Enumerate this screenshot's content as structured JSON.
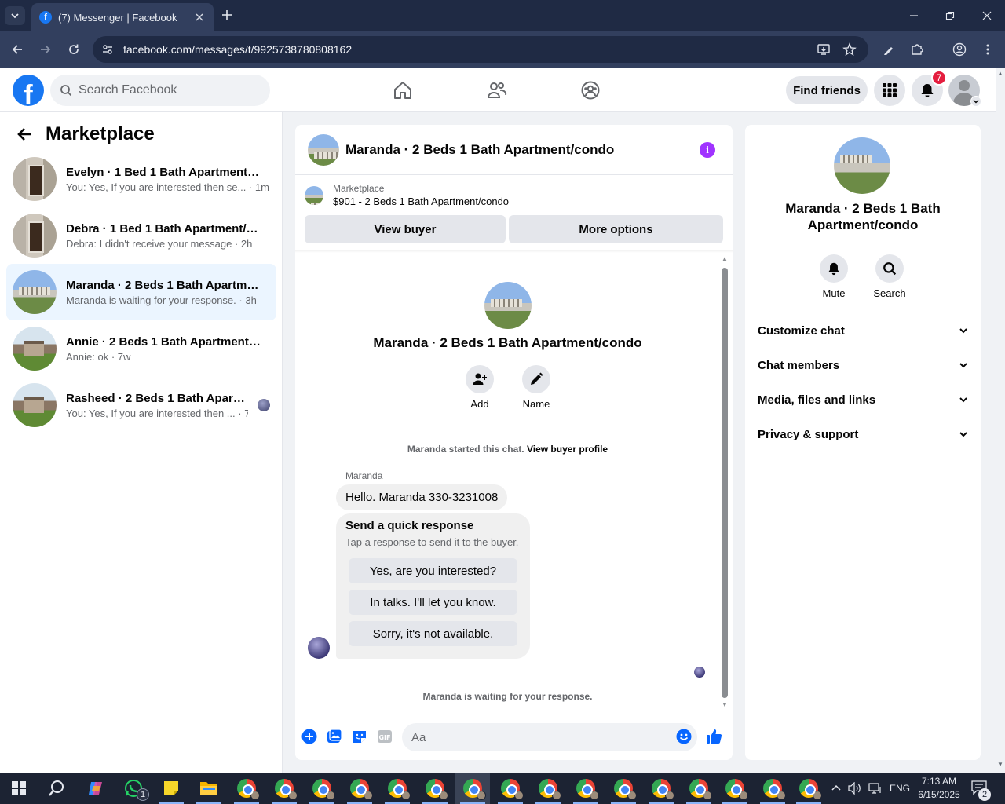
{
  "browser": {
    "tab_title": "(7) Messenger | Facebook",
    "url": "facebook.com/messages/t/9925738780808162"
  },
  "header": {
    "search_placeholder": "Search Facebook",
    "find_friends_label": "Find friends",
    "notification_count": "7"
  },
  "sidebar": {
    "title": "Marketplace",
    "conversations": [
      {
        "name": "Evelyn · 1 Bed 1 Bath Apartment/c...",
        "preview": "You: Yes, If you are interested then se...",
        "time": "1m"
      },
      {
        "name": "Debra · 1 Bed 1 Bath Apartment/co...",
        "preview": "Debra: I didn't receive your message",
        "time": "2h"
      },
      {
        "name": "Maranda · 2 Beds 1 Bath Apartmen...",
        "preview": "Maranda is waiting for your response.",
        "time": "3h"
      },
      {
        "name": "Annie · 2 Beds 1 Bath Apartment/c...",
        "preview": "Annie: ok",
        "time": "7w"
      },
      {
        "name": "Rasheed · 2 Beds 1 Bath Apartm...",
        "preview": "You: Yes, If you are interested then ...",
        "time": "7w"
      }
    ]
  },
  "chat": {
    "title": "Maranda · 2 Beds 1 Bath Apartment/condo",
    "marketplace_label": "Marketplace",
    "listing": "$901 - 2 Beds 1 Bath Apartment/condo",
    "view_buyer_label": "View buyer",
    "more_options_label": "More options",
    "intro_title": "Maranda · 2 Beds 1 Bath Apartment/condo",
    "add_label": "Add",
    "name_label": "Name",
    "started_text": "Maranda started this chat.",
    "view_profile_link": "View buyer profile",
    "sender_name": "Maranda",
    "message": "Hello. Maranda 330-3231008",
    "quick_title": "Send a quick response",
    "quick_sub": "Tap a response to send it to the buyer.",
    "quick_options": [
      "Yes, are you interested?",
      "In talks. I'll let you know.",
      "Sorry, it's not available."
    ],
    "waiting_text": "Maranda is waiting for your response.",
    "composer_placeholder": "Aa"
  },
  "info_panel": {
    "title": "Maranda · 2 Beds 1 Bath Apartment/condo",
    "mute_label": "Mute",
    "search_label": "Search",
    "sections": [
      "Customize chat",
      "Chat members",
      "Media, files and links",
      "Privacy & support"
    ]
  },
  "taskbar": {
    "language": "ENG",
    "time": "7:13 AM",
    "date": "6/15/2025",
    "whatsapp_badge": "1",
    "notifications_badge": "2"
  },
  "colors": {
    "facebook_blue": "#1877f2",
    "messenger_blue": "#0866ff",
    "info_purple": "#a033ff",
    "badge_red": "#e41e3f",
    "active_conv": "#ebf5ff"
  }
}
